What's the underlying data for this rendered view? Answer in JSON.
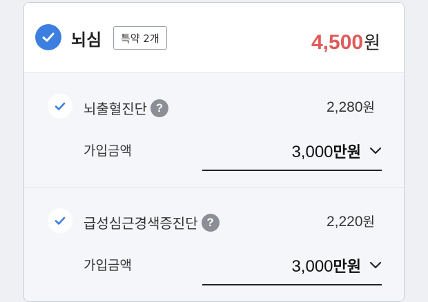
{
  "plan": {
    "title": "뇌심",
    "badge": "특약 2개",
    "total_amount": "4,500",
    "total_unit": "원",
    "accent_color": "#e05b5b",
    "check_color": "#3d7fe0"
  },
  "items": [
    {
      "name": "뇌출혈진단",
      "help": "?",
      "price": "2,280",
      "price_unit": "원",
      "coverage_label": "가입금액",
      "coverage_amount": "3,000",
      "coverage_unit": "만원"
    },
    {
      "name": "급성심근경색증진단",
      "help": "?",
      "price": "2,220",
      "price_unit": "원",
      "coverage_label": "가입금액",
      "coverage_amount": "3,000",
      "coverage_unit": "만원"
    }
  ],
  "icons": {
    "header_check": "check-circle-filled-icon",
    "item_check": "check-icon",
    "help": "question-icon",
    "dropdown": "chevron-down-icon"
  }
}
